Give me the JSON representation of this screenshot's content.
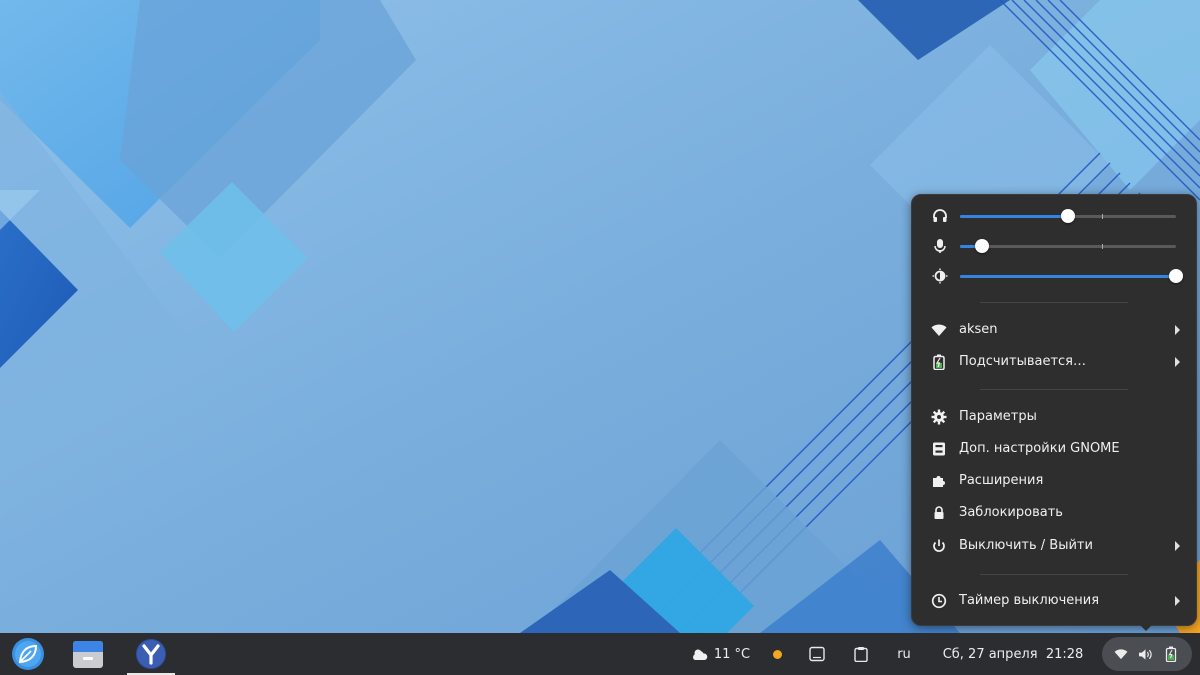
{
  "desktop": {
    "wallpaper": "blue-geometric-wallpaper"
  },
  "quick_settings": {
    "volume": {
      "icon": "headphones-icon",
      "level": 0.5
    },
    "microphone": {
      "icon": "microphone-icon",
      "level": 0.1
    },
    "brightness": {
      "icon": "brightness-icon",
      "level": 1.0
    },
    "network": {
      "icon": "wifi-icon",
      "label": "aksen"
    },
    "battery": {
      "icon": "battery-charging-icon",
      "label": "Подсчитывается…"
    },
    "items": [
      {
        "icon": "gear-icon",
        "label": "Параметры"
      },
      {
        "icon": "tweaks-icon",
        "label": "Доп. настройки GNOME"
      },
      {
        "icon": "puzzle-icon",
        "label": "Расширения"
      },
      {
        "icon": "lock-icon",
        "label": "Заблокировать"
      },
      {
        "icon": "power-icon",
        "label": "Выключить / Выйти"
      }
    ],
    "timer": {
      "icon": "clock-icon",
      "label": "Таймер выключения"
    },
    "accent_color": "#3584e4"
  },
  "taskbar": {
    "apps": [
      {
        "icon": "leaf-launcher-icon"
      },
      {
        "icon": "file-manager-icon"
      },
      {
        "icon": "yandex-browser-icon",
        "active": true
      }
    ],
    "weather": {
      "icon": "weather-icon",
      "text": "11 °C"
    },
    "status_dot_color": "#f5a623",
    "keyboard_layout": "ru",
    "datetime": "Сб, 27 апреля  21:28",
    "tray": [
      "wifi-icon",
      "volume-icon",
      "battery-charging-icon"
    ]
  }
}
